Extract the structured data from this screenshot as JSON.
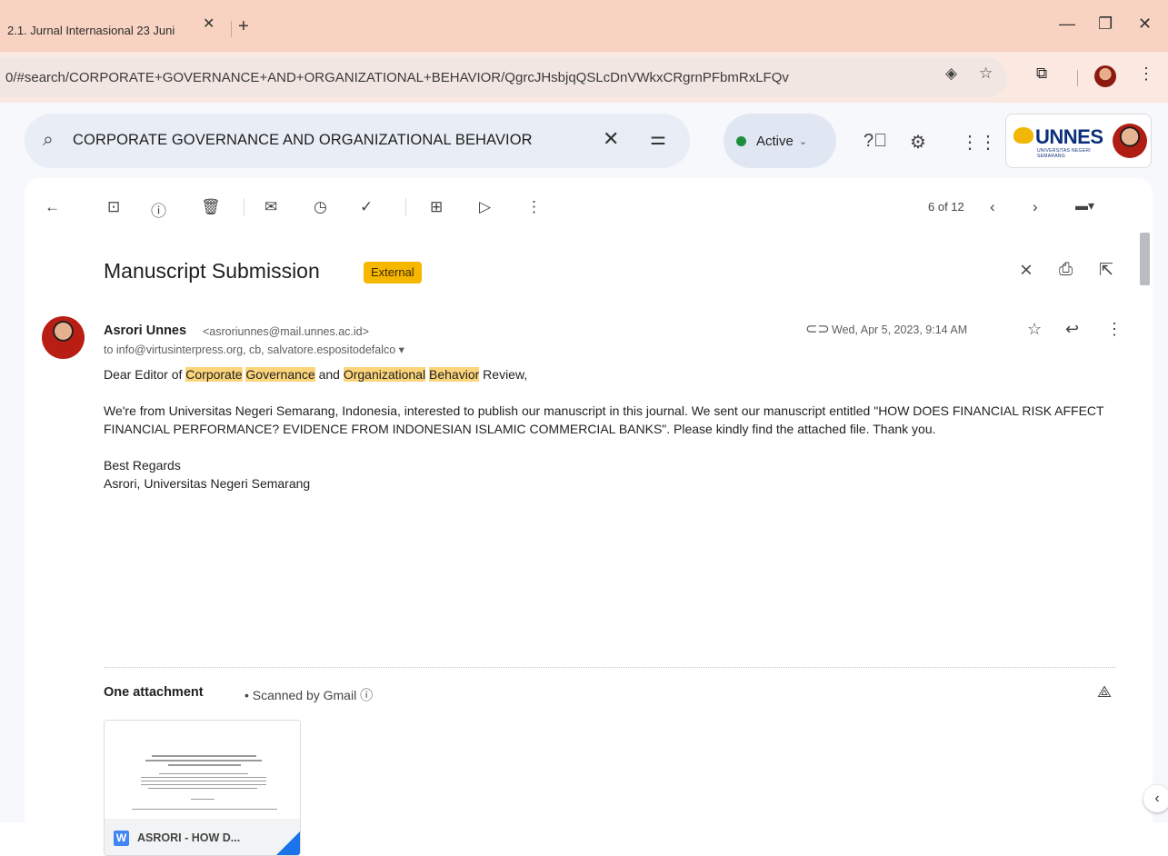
{
  "browser": {
    "tab_title": "2.1. Jurnal Internasional 23 Juni",
    "tab_close": "✕",
    "new_tab": "+",
    "url": "0/#search/CORPORATE+GOVERNANCE+AND+ORGANIZATIONAL+BEHAVIOR/QgrcJHsbjqQSLcDnVWkxCRgrnPFbmRxLFQv",
    "window_minimize": "—",
    "window_restore": "❐",
    "window_close": "✕"
  },
  "gmail": {
    "search_query": "CORPORATE GOVERNANCE AND ORGANIZATIONAL BEHAVIOR",
    "status": "Active",
    "account_logo_text": "UNNES",
    "account_logo_sub": "UNIVERSITAS NEGERI SEMARANG",
    "page_count": "6 of 12"
  },
  "email": {
    "subject": "Manuscript Submission",
    "label": "External",
    "sender_name": "Asrori Unnes",
    "sender_email": "<asroriunnes@mail.unnes.ac.id>",
    "recipients": "to info@virtusinterpress.org, cb, salvatore.espositodefalco",
    "date": "Wed, Apr 5, 2023, 9:14 AM",
    "greeting_prefix": "Dear Editor of ",
    "hl_1": "Corporate",
    "hl_2": "Governance",
    "greeting_and": " and ",
    "hl_3": "Organizational",
    "hl_4": "Behavior",
    "greeting_suffix": " Review,",
    "paragraph": "We're from Universitas Negeri Semarang, Indonesia, interested to publish our manuscript in this journal. We sent our manuscript entitled \"HOW DOES FINANCIAL RISK AFFECT FINANCIAL PERFORMANCE? EVIDENCE FROM INDONESIAN ISLAMIC COMMERCIAL BANKS\". Please kindly find the attached file. Thank you.",
    "closing": "Best Regards",
    "signature": "Asrori, Universitas Negeri Semarang"
  },
  "attachments": {
    "title": "One attachment",
    "scanned": "• Scanned by Gmail ⓘ",
    "file_type": "W",
    "file_name": "ASRORI - HOW D..."
  }
}
